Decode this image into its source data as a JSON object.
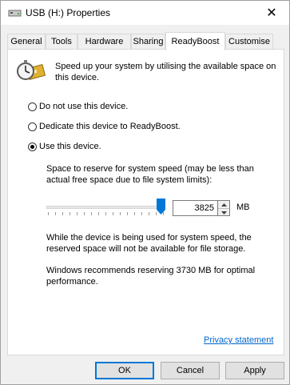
{
  "window": {
    "title": "USB (H:) Properties",
    "close_glyph": "✕"
  },
  "tabs": [
    {
      "label": "General"
    },
    {
      "label": "Tools"
    },
    {
      "label": "Hardware"
    },
    {
      "label": "Sharing"
    },
    {
      "label": "ReadyBoost",
      "active": true
    },
    {
      "label": "Customise"
    }
  ],
  "readyboost": {
    "description": "Speed up your system by utilising the available space on this device.",
    "options": [
      {
        "label": "Do not use this device.",
        "selected": false
      },
      {
        "label": "Dedicate this device to ReadyBoost.",
        "selected": false
      },
      {
        "label": "Use this device.",
        "selected": true
      }
    ],
    "reserve_label": "Space to reserve for system speed (may be less than actual free space due to file system limits):",
    "reserve_value": "3825",
    "slider_fraction": 0.96,
    "unit": "MB",
    "usage_note": "While the device is being used for system speed, the reserved space will not be available for file storage.",
    "recommendation": "Windows recommends reserving 3730 MB for optimal performance.",
    "privacy_link": "Privacy statement"
  },
  "buttons": {
    "ok": "OK",
    "cancel": "Cancel",
    "apply": "Apply"
  },
  "colors": {
    "accent": "#0078d7",
    "link": "#0066cc"
  }
}
